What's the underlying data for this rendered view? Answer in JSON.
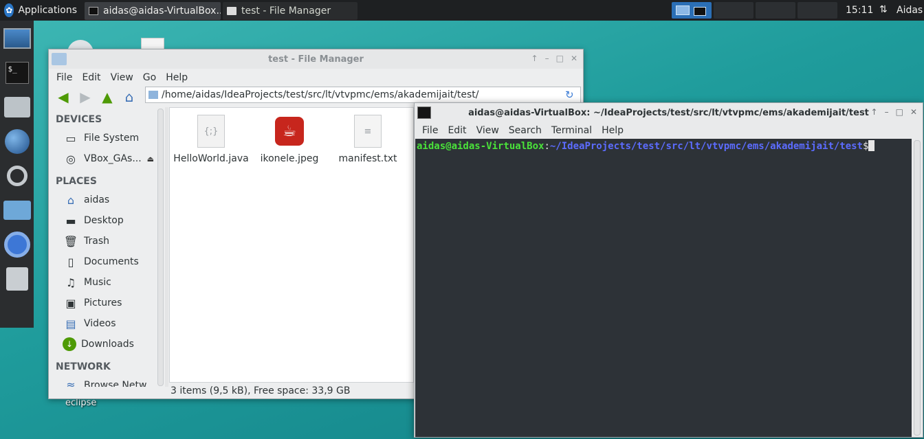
{
  "panel": {
    "apps_label": "Applications",
    "tasks": [
      {
        "label": "aidas@aidas-VirtualBox..."
      },
      {
        "label": "test - File Manager"
      }
    ],
    "clock": "15:11",
    "user": "Aidas"
  },
  "desktop": {
    "eclipse_label": "eclipse"
  },
  "file_manager": {
    "title": "test - File Manager",
    "menu": [
      "File",
      "Edit",
      "View",
      "Go",
      "Help"
    ],
    "path": "/home/aidas/IdeaProjects/test/src/lt/vtvpmc/ems/akademijait/test/",
    "sidebar": {
      "devices_heading": "DEVICES",
      "devices": [
        "File System",
        "VBox_GAs..."
      ],
      "places_heading": "PLACES",
      "places": [
        "aidas",
        "Desktop",
        "Trash",
        "Documents",
        "Music",
        "Pictures",
        "Videos",
        "Downloads"
      ],
      "network_heading": "NETWORK",
      "network": [
        "Browse Netw..."
      ]
    },
    "files": [
      {
        "name": "HelloWorld.java",
        "icon": "{;}"
      },
      {
        "name": "ikonele.jpeg",
        "icon": "java-logo-icon"
      },
      {
        "name": "manifest.txt",
        "icon": "text-file-icon"
      }
    ],
    "status": "3 items (9,5 kB), Free space: 33,9 GB"
  },
  "terminal": {
    "title": "aidas@aidas-VirtualBox: ~/IdeaProjects/test/src/lt/vtvpmc/ems/akademijait/test",
    "menu": [
      "File",
      "Edit",
      "View",
      "Search",
      "Terminal",
      "Help"
    ],
    "prompt_user": "aidas@aidas-VirtualBox",
    "prompt_sep": ":",
    "prompt_cwd": "~/IdeaProjects/test/src/lt/vtvpmc/ems/akademijait/test",
    "prompt_dollar": "$"
  },
  "colors": {
    "prompt_user": "#4ae23a",
    "prompt_cwd": "#5c6cff",
    "terminal_bg": "#2d3237",
    "desktop_bg": "#1f9c9c"
  }
}
